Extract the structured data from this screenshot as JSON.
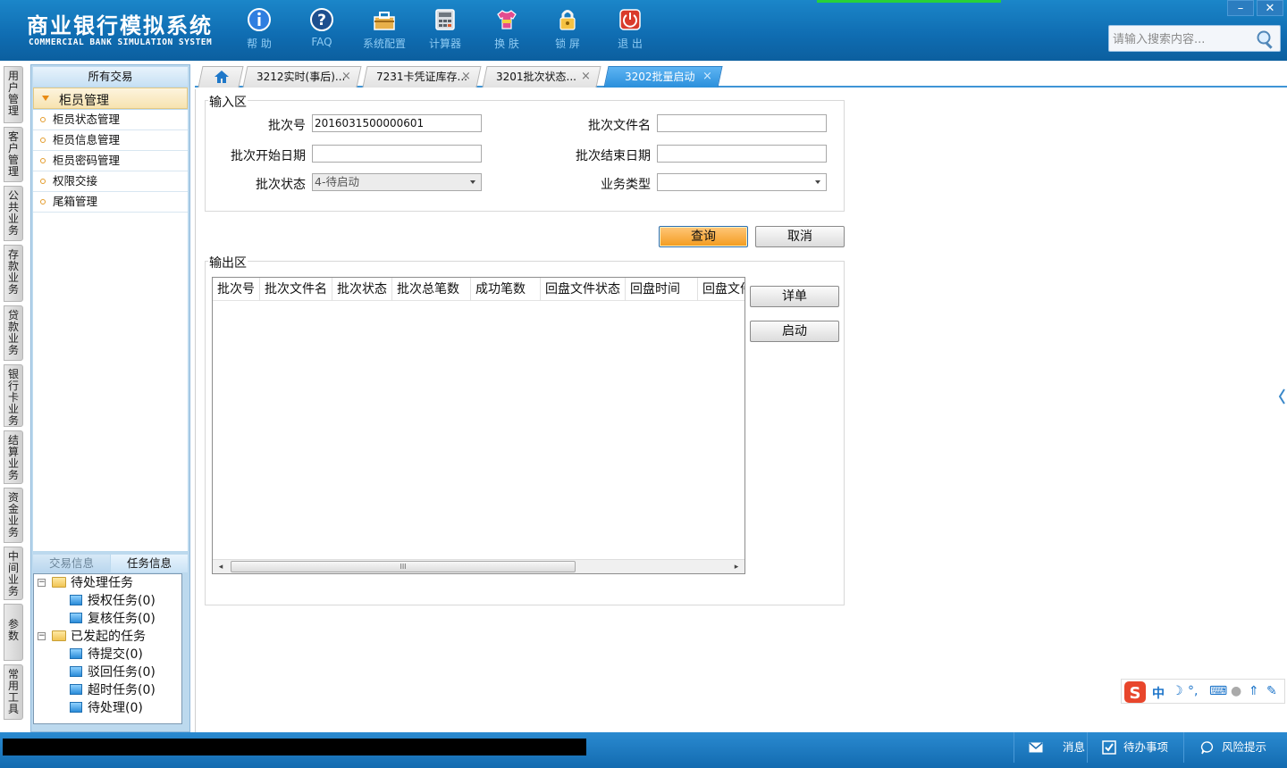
{
  "app": {
    "title_cn": "商业银行模拟系统",
    "title_en": "COMMERCIAL BANK SIMULATION SYSTEM"
  },
  "toolbar": [
    {
      "label": "帮 助",
      "icon": "info-icon"
    },
    {
      "label": "FAQ",
      "icon": "help-icon"
    },
    {
      "label": "系统配置",
      "icon": "toolbox-icon"
    },
    {
      "label": "计算器",
      "icon": "calculator-icon"
    },
    {
      "label": "换 肤",
      "icon": "shirt-icon"
    },
    {
      "label": "锁 屏",
      "icon": "lock-icon"
    },
    {
      "label": "退 出",
      "icon": "power-icon"
    }
  ],
  "window_controls": {
    "minimize": "–",
    "close": "✕"
  },
  "search": {
    "placeholder": "请输入搜索内容..."
  },
  "vnav": [
    "用户管理",
    "客户管理",
    "公共业务",
    "存款业务",
    "贷款业务",
    "银行卡业务",
    "结算业务",
    "资金业务",
    "中间业务",
    "参数",
    "常用工具"
  ],
  "sidebar": {
    "header": "所有交易",
    "group": "柜员管理",
    "items": [
      "柜员状态管理",
      "柜员信息管理",
      "柜员密码管理",
      "权限交接",
      "尾箱管理"
    ],
    "tabs": [
      "交易信息",
      "任务信息"
    ],
    "tree": {
      "pending": "待处理任务",
      "auth": "授权任务(0)",
      "review": "复核任务(0)",
      "initiated": "已发起的任务",
      "to_submit": "待提交(0)",
      "rejected": "驳回任务(0)",
      "timeout": "超时任务(0)",
      "to_process": "待处理(0)"
    }
  },
  "tabs": [
    {
      "label": "3212实时(事后)..."
    },
    {
      "label": "7231卡凭证库存..."
    },
    {
      "label": "3201批次状态..."
    },
    {
      "label": "3202批量启动"
    }
  ],
  "form": {
    "input_legend": "输入区",
    "batch_no_label": "批次号",
    "batch_no_value": "2016031500000601",
    "batch_file_label": "批次文件名",
    "batch_file_value": "",
    "start_date_label": "批次开始日期",
    "start_date_value": "",
    "end_date_label": "批次结束日期",
    "end_date_value": "",
    "status_label": "批次状态",
    "status_value": "4-待启动",
    "biz_type_label": "业务类型",
    "biz_type_value": "",
    "query_button": "查询",
    "cancel_button": "取消",
    "output_legend": "输出区",
    "detail_button": "详单",
    "start_button": "启动"
  },
  "grid": {
    "columns": [
      "批次号",
      "批次文件名",
      "批次状态",
      "批次总笔数",
      "成功笔数",
      "回盘文件状态",
      "回盘时间",
      "回盘文件"
    ],
    "rows": [],
    "scroll_thumb": "III"
  },
  "ime": [
    "中",
    "☽",
    "°,",
    "⌨",
    "●",
    "⇑",
    "✎"
  ],
  "statusbar": {
    "messages": "消息",
    "todo": "待办事项",
    "risk": "风险提示"
  },
  "colors": {
    "header": "#0f6cb1",
    "accent": "#2a8fdb",
    "primary_button": "#f39b1e"
  }
}
